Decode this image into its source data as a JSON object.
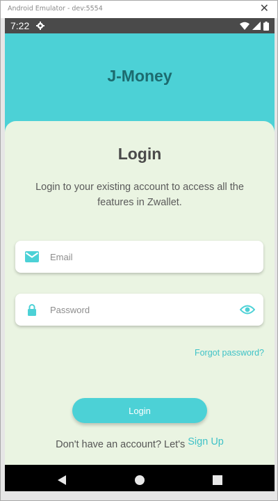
{
  "window": {
    "title": "Android Emulator - dev:5554",
    "close_glyph": "✕"
  },
  "status_bar": {
    "time": "7:22",
    "icons": [
      "settings-icon",
      "wifi-icon",
      "signal-icon",
      "battery-icon"
    ]
  },
  "app": {
    "brand": "J-Money",
    "heading": "Login",
    "description": "Login to your existing account to access all the features in Zwallet.",
    "email": {
      "placeholder": "Email",
      "value": "",
      "icon": "mail-icon"
    },
    "password": {
      "placeholder": "Password",
      "value": "",
      "icon": "lock-icon",
      "toggle_icon": "eye-icon"
    },
    "forgot_password": "Forgot password?",
    "login_button": "Login",
    "signup_prompt": "Don't have an account? Let's",
    "signup_link": "Sign Up"
  },
  "nav_bar": {
    "buttons": [
      "back-icon",
      "home-icon",
      "recents-icon"
    ]
  },
  "colors": {
    "accent": "#4cd1d6",
    "brand_text": "#1c6b6f",
    "sheet_background": "#eaf4e2",
    "link": "#3fc2c7"
  }
}
